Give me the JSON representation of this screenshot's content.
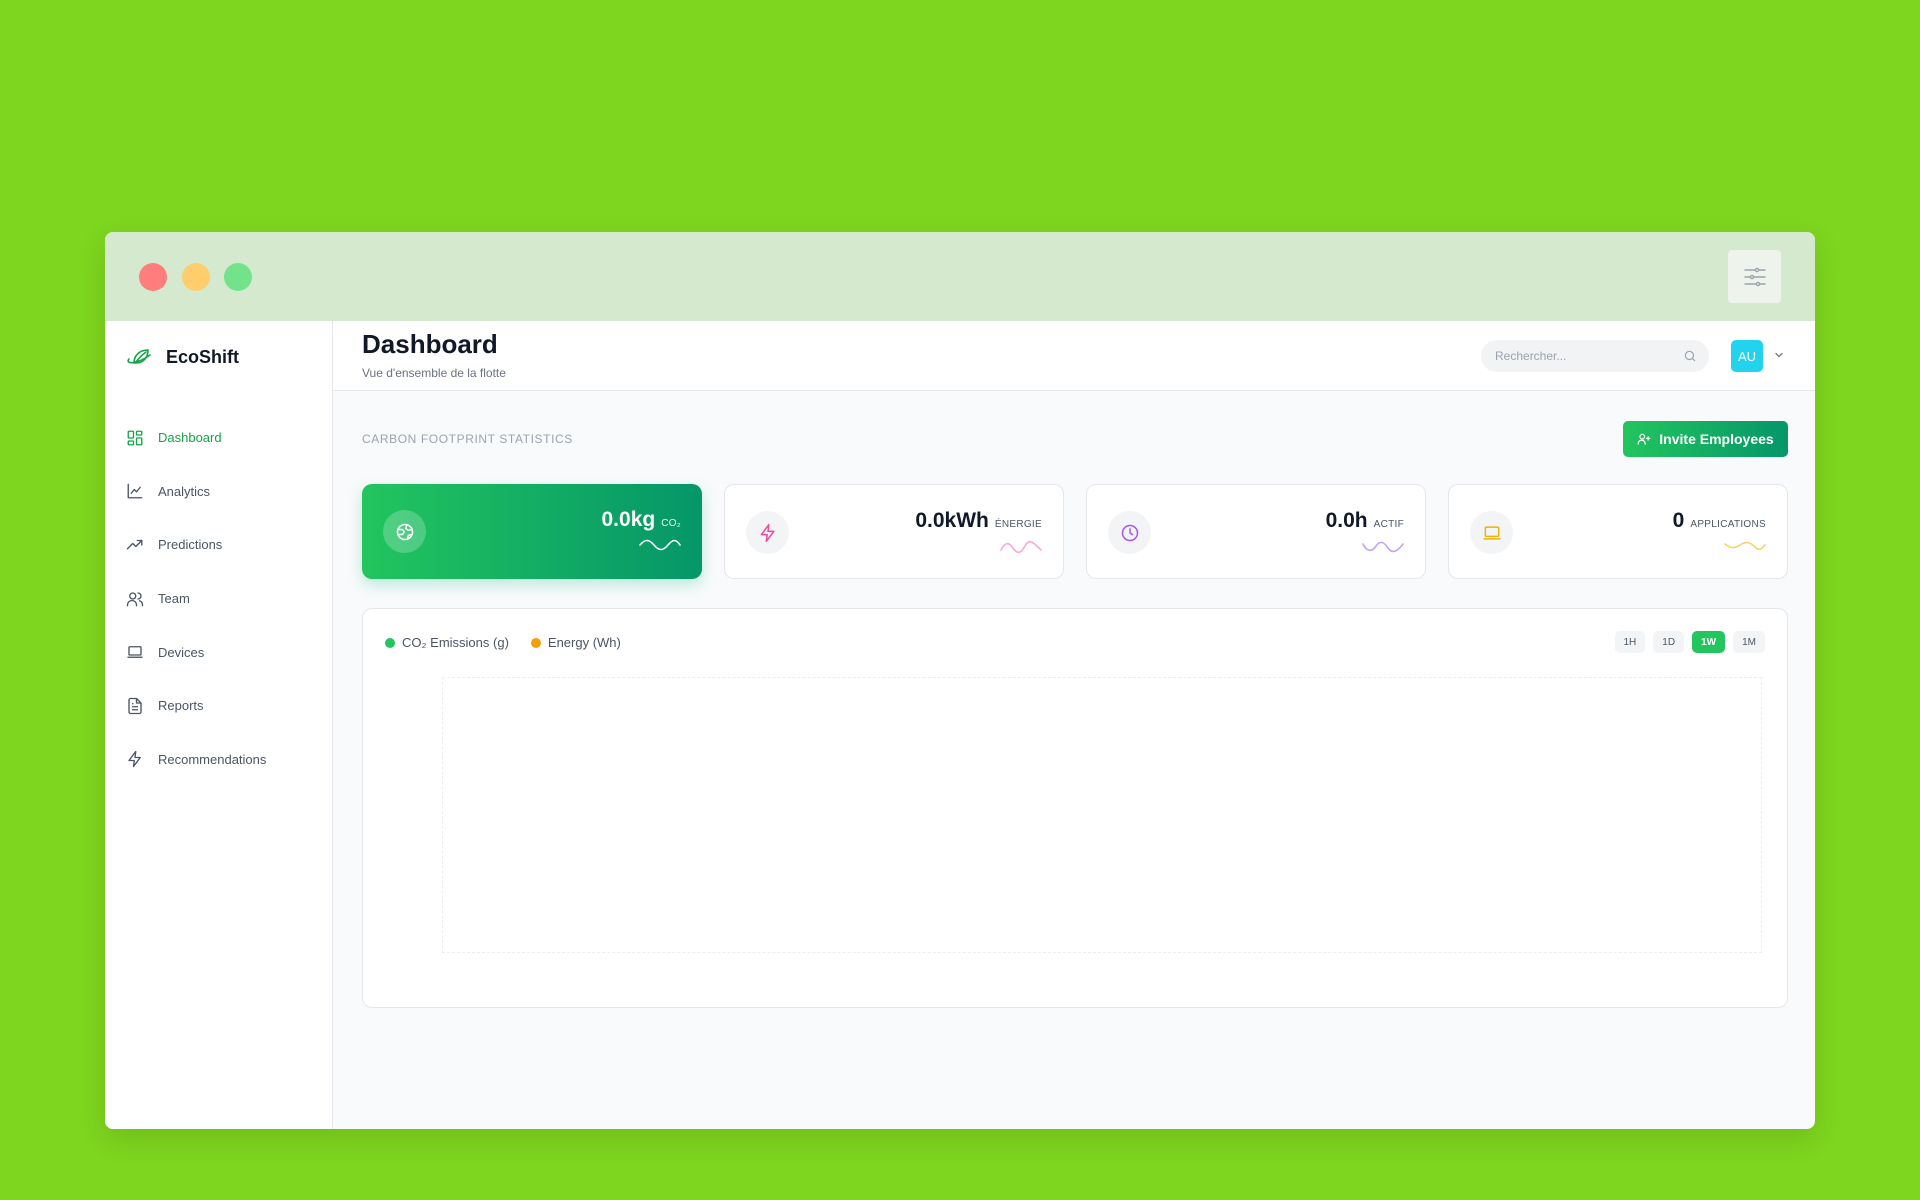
{
  "app": {
    "name": "EcoShift"
  },
  "sidebar": {
    "items": [
      {
        "label": "Dashboard",
        "icon": "dashboard-grid-icon",
        "active": true
      },
      {
        "label": "Analytics",
        "icon": "line-chart-icon"
      },
      {
        "label": "Predictions",
        "icon": "trending-up-icon"
      },
      {
        "label": "Team",
        "icon": "users-icon"
      },
      {
        "label": "Devices",
        "icon": "laptop-icon"
      },
      {
        "label": "Reports",
        "icon": "file-text-icon"
      },
      {
        "label": "Recommendations",
        "icon": "zap-icon"
      }
    ]
  },
  "header": {
    "title": "Dashboard",
    "subtitle": "Vue d'ensemble de la flotte",
    "search_placeholder": "Rechercher...",
    "avatar_initials": "AU"
  },
  "stats": {
    "section_label": "CARBON FOOTPRINT STATISTICS",
    "invite_label": "Invite Employees",
    "cards": [
      {
        "value": "0.0kg",
        "unit": "CO₂",
        "icon": "globe-icon",
        "color": "#22c55e"
      },
      {
        "value": "0.0kWh",
        "unit": "ÉNERGIE",
        "icon": "zap-icon",
        "color": "#ec4899"
      },
      {
        "value": "0.0h",
        "unit": "ACTIF",
        "icon": "clock-icon",
        "color": "#a855f7"
      },
      {
        "value": "0",
        "unit": "APPLICATIONS",
        "icon": "laptop-icon",
        "color": "#eab308"
      }
    ]
  },
  "chart": {
    "legend": [
      {
        "label": "CO₂ Emissions (g)",
        "color": "#22c55e"
      },
      {
        "label": "Energy (Wh)",
        "color": "#f59e0b"
      }
    ],
    "ranges": [
      {
        "label": "1H"
      },
      {
        "label": "1D"
      },
      {
        "label": "1W",
        "active": true
      },
      {
        "label": "1M"
      }
    ]
  },
  "chart_data": {
    "type": "line",
    "series": [
      {
        "name": "CO₂ Emissions (g)",
        "values": []
      },
      {
        "name": "Energy (Wh)",
        "values": []
      }
    ],
    "x": [],
    "grid": false,
    "legend": "top-left"
  }
}
